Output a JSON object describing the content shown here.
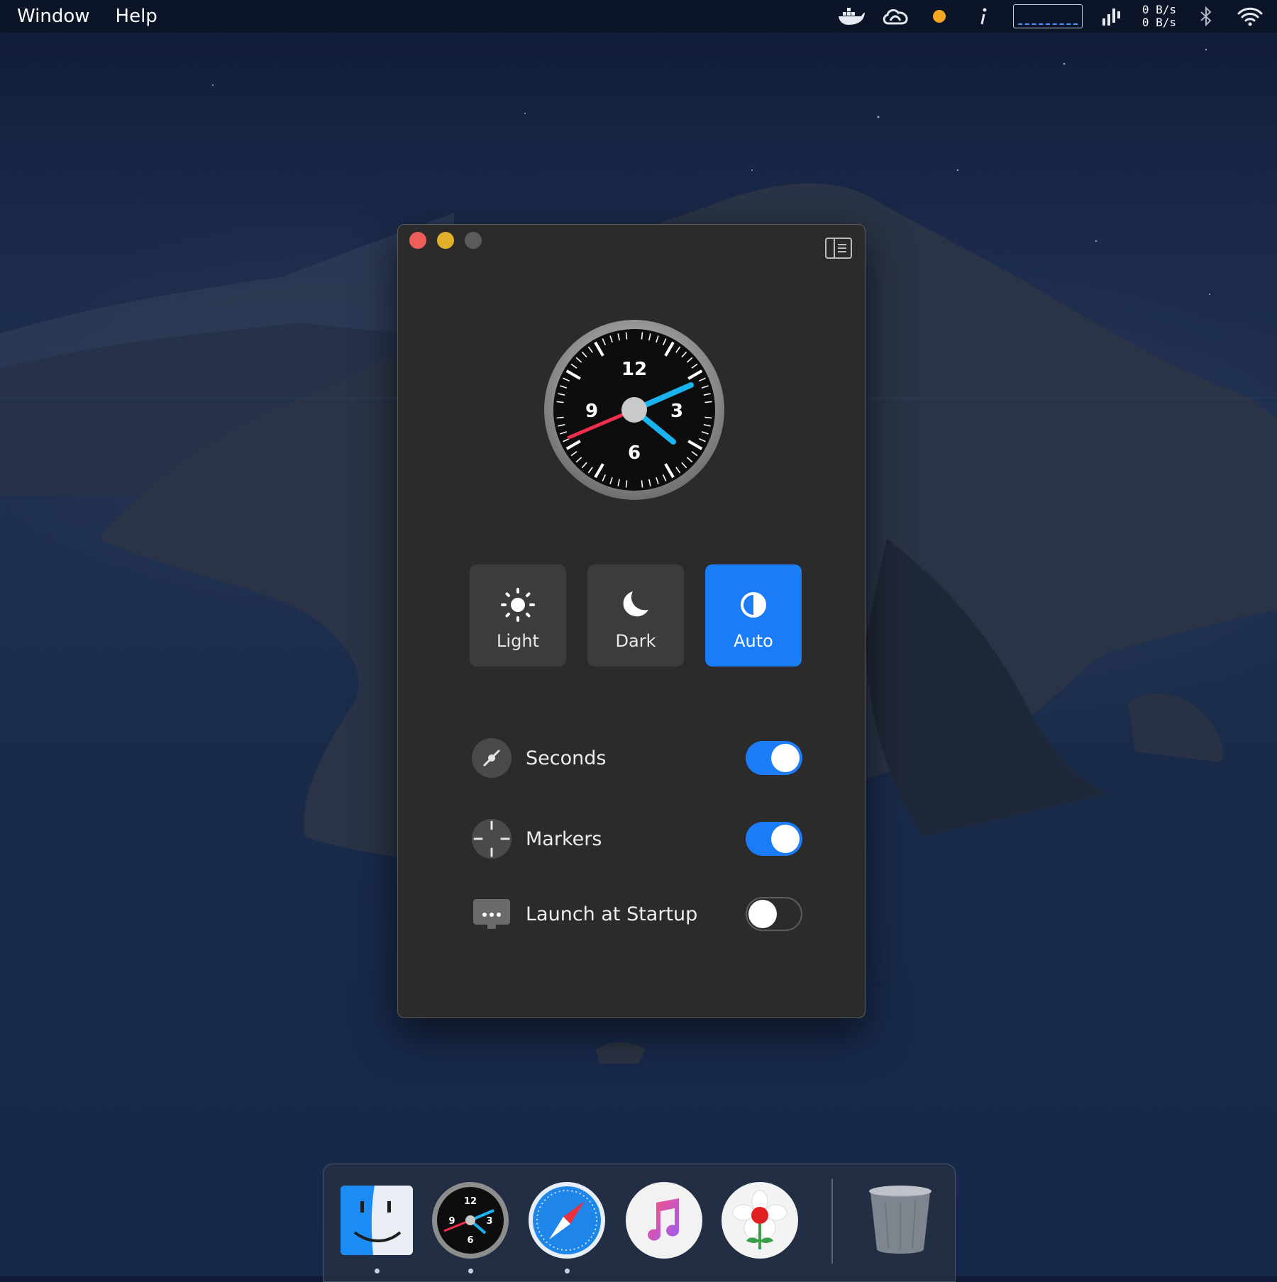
{
  "menubar": {
    "items": [
      "Window",
      "Help"
    ],
    "status": {
      "icons": [
        "docker-icon",
        "creative-cloud-icon",
        "orange-dot-icon",
        "info-icon",
        "network-graph-icon",
        "signal-bars-icon",
        "bluetooth-icon",
        "wifi-icon"
      ],
      "net_up": "0 B/s",
      "net_down": "0 B/s"
    }
  },
  "window": {
    "theme_buttons": [
      {
        "label": "Light",
        "icon": "sun-icon",
        "selected": false
      },
      {
        "label": "Dark",
        "icon": "moon-icon",
        "selected": false
      },
      {
        "label": "Auto",
        "icon": "half-circle-icon",
        "selected": true
      }
    ],
    "clock": {
      "numerals": [
        "12",
        "3",
        "6",
        "9"
      ]
    },
    "options": [
      {
        "label": "Seconds",
        "icon": "seconds-hand-icon",
        "on": true
      },
      {
        "label": "Markers",
        "icon": "markers-icon",
        "on": true
      },
      {
        "label": "Launch at Startup",
        "icon": "startup-display-icon",
        "on": false
      }
    ]
  },
  "dock": {
    "apps": [
      "finder-icon",
      "clock-app-icon",
      "safari-icon",
      "music-icon",
      "flower-app-icon",
      "trash-icon"
    ]
  },
  "colors": {
    "accent": "#1a7cf8",
    "window_bg": "#2b2b2b",
    "close": "#ed5f58",
    "minimize": "#e0b02a"
  }
}
